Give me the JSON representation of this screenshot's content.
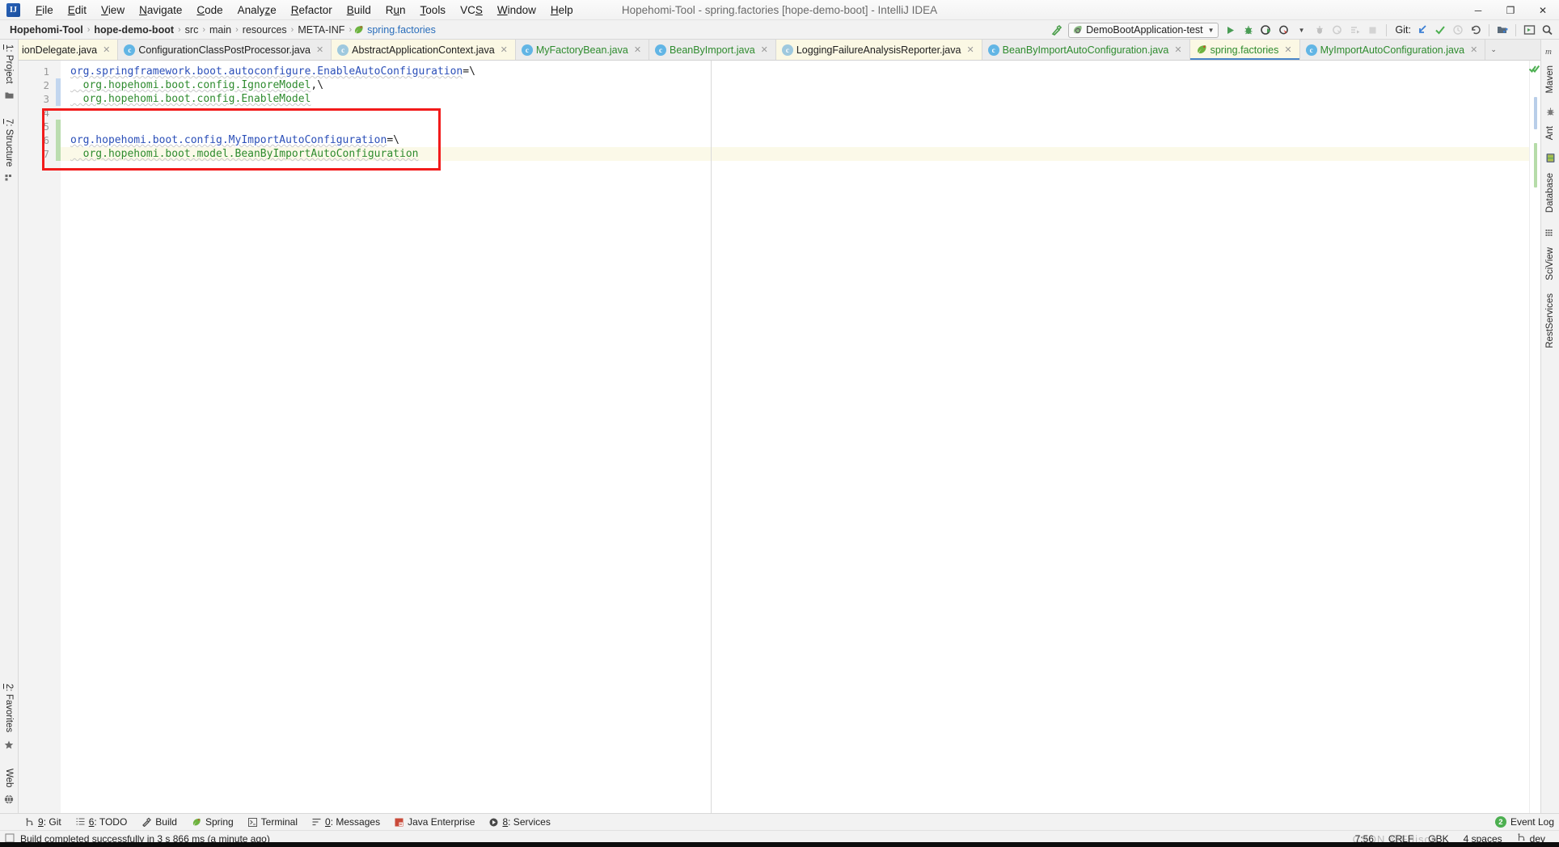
{
  "window": {
    "title": "Hopehomi-Tool - spring.factories [hope-demo-boot] - IntelliJ IDEA",
    "logo": "intellij-idea-logo",
    "minimize": "─",
    "maximize": "❐",
    "close": "✕"
  },
  "menubar": {
    "items": [
      {
        "label": "File"
      },
      {
        "label": "Edit"
      },
      {
        "label": "View"
      },
      {
        "label": "Navigate"
      },
      {
        "label": "Code"
      },
      {
        "label": "Analyze"
      },
      {
        "label": "Refactor"
      },
      {
        "label": "Build"
      },
      {
        "label": "Run"
      },
      {
        "label": "Tools"
      },
      {
        "label": "VCS"
      },
      {
        "label": "Window"
      },
      {
        "label": "Help"
      }
    ]
  },
  "toolbar": {
    "breadcrumb": [
      {
        "label": "Hopehomi-Tool",
        "bold": true
      },
      {
        "label": "hope-demo-boot",
        "bold": true
      },
      {
        "label": "src",
        "bold": false
      },
      {
        "label": "main",
        "bold": false
      },
      {
        "label": "resources",
        "bold": false
      },
      {
        "label": "META-INF",
        "bold": false
      },
      {
        "label": "spring.factories",
        "bold": false,
        "file": true
      }
    ],
    "separator": "›",
    "build_icon": "hammer-icon",
    "run_configuration": "DemoBootApplication-test",
    "run_config_dropdown": "▼",
    "git_label": "Git:",
    "actions": [
      {
        "name": "run-button",
        "glyph": "▶"
      },
      {
        "name": "debug-button",
        "glyph": "☣"
      },
      {
        "name": "run-with-coverage-button",
        "glyph": "◐"
      },
      {
        "name": "profile-button",
        "glyph": "◴"
      },
      {
        "name": "stop-button",
        "glyph": "■"
      }
    ]
  },
  "tool_windows": {
    "left_top": [
      {
        "label": "1: Project",
        "icon": "folder-icon"
      },
      {
        "label": "7: Structure",
        "icon": "structure-icon"
      }
    ],
    "left_bottom": [
      {
        "label": "2: Favorites",
        "icon": "star-icon"
      },
      {
        "label": "Web",
        "icon": "globe-icon"
      }
    ],
    "right": [
      {
        "label": "Maven",
        "icon": "maven-icon"
      },
      {
        "label": "Ant",
        "icon": "ant-icon"
      },
      {
        "label": "Database",
        "icon": "database-icon"
      },
      {
        "label": "SciView",
        "icon": "sciview-icon"
      },
      {
        "label": "RestServices",
        "icon": "restservices-icon"
      }
    ]
  },
  "editor_tabs": [
    {
      "label": "ionDelegate.java",
      "icon": "java-class-icon",
      "color": "dark",
      "active": false,
      "clipped": true
    },
    {
      "label": "ConfigurationClassPostProcessor.java",
      "icon": "java-class-icon",
      "color": "dark",
      "active": false
    },
    {
      "label": "AbstractApplicationContext.java",
      "icon": "java-class-icon-muted",
      "color": "dark",
      "active": false,
      "highlight": true
    },
    {
      "label": "MyFactoryBean.java",
      "icon": "java-class-icon",
      "color": "green",
      "active": false
    },
    {
      "label": "BeanByImport.java",
      "icon": "java-class-icon",
      "color": "green",
      "active": false
    },
    {
      "label": "LoggingFailureAnalysisReporter.java",
      "icon": "java-class-icon-muted",
      "color": "dark",
      "active": false,
      "highlight": true
    },
    {
      "label": "BeanByImportAutoConfiguration.java",
      "icon": "java-class-icon",
      "color": "green",
      "active": false
    },
    {
      "label": "spring.factories",
      "icon": "spring-leaf-icon",
      "color": "green",
      "active": true
    },
    {
      "label": "MyImportAutoConfiguration.java",
      "icon": "java-class-icon",
      "color": "green",
      "active": false
    }
  ],
  "tab_overflow_chevron": "⌄",
  "editor": {
    "file": "spring.factories",
    "lines": [
      {
        "num": "1",
        "segments": [
          {
            "text": "org.springframework.boot.autoconfigure.EnableAutoConfiguration",
            "type": "key"
          },
          {
            "text": "=\\",
            "type": "sep"
          }
        ],
        "highlight": false,
        "vcs": "none"
      },
      {
        "num": "2",
        "segments": [
          {
            "text": "  org.hopehomi.boot.config.IgnoreModel",
            "type": "val"
          },
          {
            "text": ",\\",
            "type": "sep"
          }
        ],
        "highlight": false,
        "vcs": "modified"
      },
      {
        "num": "3",
        "segments": [
          {
            "text": "  org.hopehomi.boot.config.EnableModel",
            "type": "val"
          }
        ],
        "highlight": false,
        "vcs": "modified"
      },
      {
        "num": "4",
        "segments": [
          {
            "text": "",
            "type": "plain"
          }
        ],
        "highlight": false,
        "vcs": "none"
      },
      {
        "num": "5",
        "segments": [
          {
            "text": "",
            "type": "plain"
          }
        ],
        "highlight": false,
        "vcs": "added"
      },
      {
        "num": "6",
        "segments": [
          {
            "text": "org.hopehomi.boot.config.MyImportAutoConfiguration",
            "type": "key"
          },
          {
            "text": "=\\",
            "type": "sep"
          }
        ],
        "highlight": false,
        "vcs": "added"
      },
      {
        "num": "7",
        "segments": [
          {
            "text": "  org.hopehomi.boot.model.BeanByImportAutoConfiguration",
            "type": "val"
          }
        ],
        "highlight": true,
        "vcs": "added"
      }
    ],
    "inspection_status": "no-errors-checkmark",
    "annotation": {
      "name": "red-highlight-box"
    }
  },
  "bottom_tool_windows": [
    {
      "label": "9: Git",
      "icon": "git-branch-icon"
    },
    {
      "label": "6: TODO",
      "icon": "todo-list-icon"
    },
    {
      "label": "Build",
      "icon": "hammer-icon"
    },
    {
      "label": "Spring",
      "icon": "spring-leaf-icon"
    },
    {
      "label": "Terminal",
      "icon": "terminal-icon"
    },
    {
      "label": "0: Messages",
      "icon": "messages-icon"
    },
    {
      "label": "Java Enterprise",
      "icon": "java-enterprise-icon"
    },
    {
      "label": "8: Services",
      "icon": "services-icon"
    }
  ],
  "event_log": {
    "label": "Event Log",
    "count": "2"
  },
  "statusbar": {
    "message": "Build completed successfully in 3 s 866 ms (a minute ago)",
    "message_icon": "build-status-icon",
    "caret_position": "7:56",
    "line_separator": "CRLF",
    "encoding": "GBK",
    "indent": "4 spaces",
    "branch": "dev",
    "branch_icon": "git-branch-icon"
  },
  "watermark": "CSDN @Edison",
  "colors": {
    "accent_blue": "#2a6ebb",
    "vcs_green": "#2e8b2e",
    "annotation_red": "#f21b1b",
    "active_tab_bg": "#fbf8e4",
    "toolbar_bg": "#f2f2f2",
    "editor_bg": "#ffffff"
  }
}
